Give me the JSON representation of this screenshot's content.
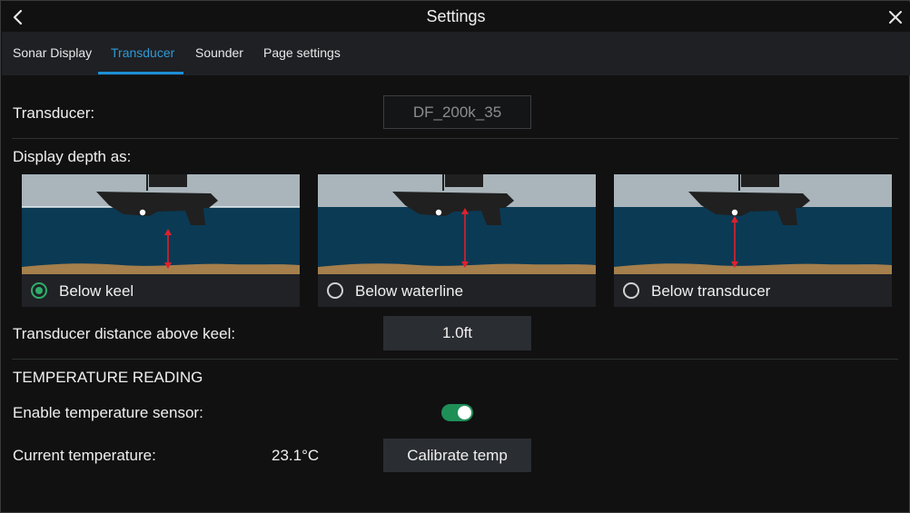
{
  "header": {
    "title": "Settings",
    "back_icon": "chevron-left-icon",
    "close_icon": "close-icon"
  },
  "tabs": [
    {
      "label": "Sonar Display",
      "active": false
    },
    {
      "label": "Transducer",
      "active": true
    },
    {
      "label": "Sounder",
      "active": false
    },
    {
      "label": "Page settings",
      "active": false
    }
  ],
  "transducer": {
    "label": "Transducer:",
    "value": "DF_200k_35"
  },
  "depth": {
    "label": "Display depth as:",
    "options": [
      {
        "label": "Below keel",
        "selected": true
      },
      {
        "label": "Below waterline",
        "selected": false
      },
      {
        "label": "Below transducer",
        "selected": false
      }
    ]
  },
  "distance": {
    "label": "Transducer distance above keel:",
    "value": "1.0ft"
  },
  "temperature": {
    "section_title": "TEMPERATURE READING",
    "enable_label": "Enable temperature sensor:",
    "enabled": true,
    "current_label": "Current temperature:",
    "current_value": "23.1°C",
    "calibrate_label": "Calibrate temp"
  },
  "colors": {
    "accent_tab": "#2e9ad6",
    "radio_selected": "#2fae6a",
    "toggle_on": "#1f8f58",
    "sky": "#a9b5bb",
    "water": "#0b3a55",
    "seabed": "#a57f4c",
    "arrow": "#e0202a"
  }
}
